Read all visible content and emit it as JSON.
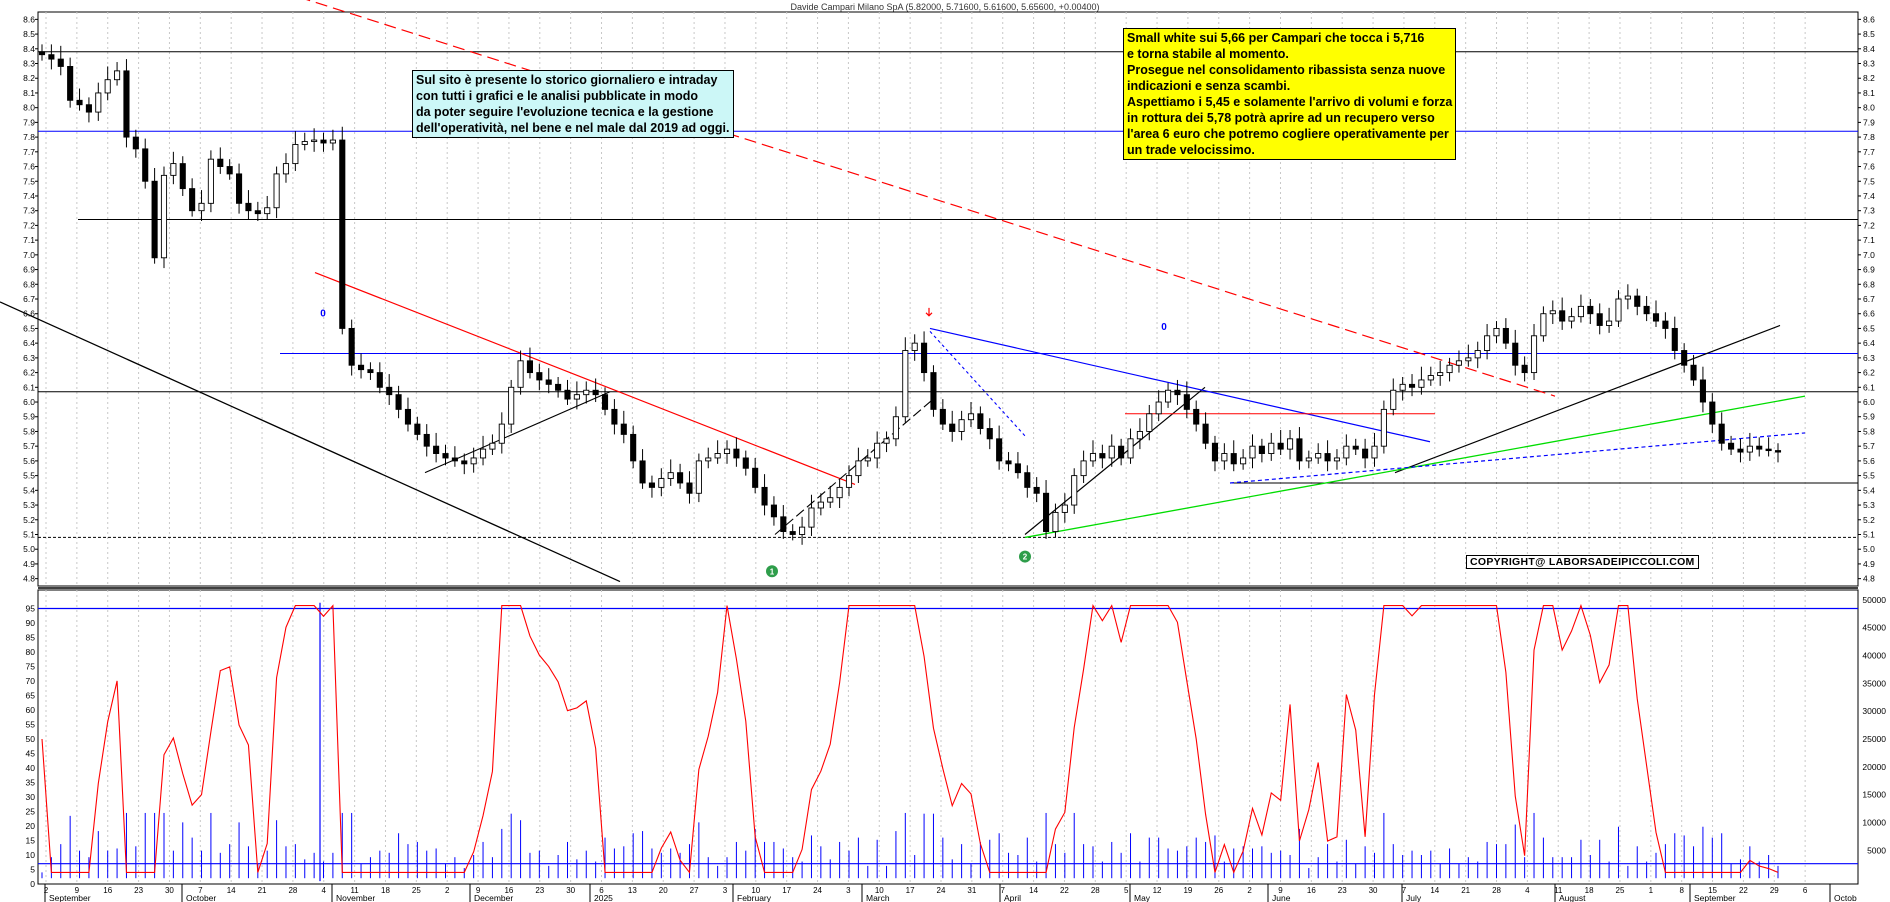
{
  "title": "Davide Campari Milano SpA (5.82000, 5.71600, 5.61600, 5.65600, +0.00400)",
  "notes": {
    "left_box": "Sul sito è presente lo storico giornaliero e intraday\ncon tutti i grafici e le analisi pubblicate in modo\nda poter seguire l'evoluzione tecnica e la gestione\ndell'operatività, nel bene e nel male dal 2019 ad oggi.",
    "right_box": "Small white sui 5,66 per Campari che tocca i 5,716\ne torna stabile al momento.\nProsegue nel consolidamento ribassista senza nuove\nindicazioni e senza scambi.\nAspettiamo i 5,45 e solamente l'arrivo di volumi e forza\nin rottura dei 5,78 potrà aprire ad un recupero verso\nl'area 6 euro che potremo cogliere operativamente per\nun trade velocissimo.",
    "copyright": "COPYRIGHT@ LABORSADEIPICCOLI.COM"
  },
  "colors": {
    "candle": "#000000",
    "trend_red": "#ff0000",
    "trend_blue": "#0000ff",
    "trend_green": "#00dd00",
    "oscillator": "#ff0000",
    "volume": "#0000ff"
  },
  "chart_data": [
    {
      "type": "candlestick",
      "ylim": [
        4.75,
        8.65
      ],
      "y_ticks": [
        "4.8",
        "4.9",
        "5.0",
        "5.1",
        "5.2",
        "5.3",
        "5.4",
        "5.5",
        "5.6",
        "5.7",
        "5.8",
        "5.9",
        "6.0",
        "6.1",
        "6.2",
        "6.3",
        "6.4",
        "6.5",
        "6.6",
        "6.7",
        "6.8",
        "6.9",
        "7.0",
        "7.1",
        "7.2",
        "7.3",
        "7.4",
        "7.5",
        "7.6",
        "7.7",
        "7.8",
        "7.9",
        "8.0",
        "8.1",
        "8.2",
        "8.3",
        "8.4",
        "8.5",
        "8.6"
      ],
      "horizontal_levels": [
        8.38,
        7.84,
        7.24,
        6.33,
        6.07,
        5.45,
        5.08
      ],
      "marker_labels": [
        "1",
        "2",
        "0",
        "0"
      ],
      "closes": [
        8.36,
        8.33,
        8.28,
        8.05,
        8.02,
        7.97,
        8.1,
        8.19,
        8.25,
        7.8,
        7.72,
        7.5,
        6.98,
        7.54,
        7.62,
        7.45,
        7.3,
        7.35,
        7.65,
        7.6,
        7.55,
        7.35,
        7.3,
        7.28,
        7.32,
        7.55,
        7.62,
        7.75,
        7.77,
        7.78,
        7.76,
        7.78,
        6.5,
        6.25,
        6.22,
        6.2,
        6.1,
        6.05,
        5.95,
        5.85,
        5.78,
        5.7,
        5.65,
        5.62,
        5.6,
        5.58,
        5.62,
        5.68,
        5.72,
        5.85,
        6.1,
        6.28,
        6.2,
        6.15,
        6.12,
        6.08,
        6.02,
        6.05,
        6.08,
        6.05,
        5.95,
        5.85,
        5.78,
        5.6,
        5.45,
        5.42,
        5.48,
        5.52,
        5.45,
        5.38,
        5.6,
        5.62,
        5.65,
        5.68,
        5.62,
        5.55,
        5.42,
        5.3,
        5.22,
        5.12,
        5.1,
        5.15,
        5.28,
        5.32,
        5.35,
        5.42,
        5.5,
        5.6,
        5.62,
        5.72,
        5.75,
        5.9,
        6.35,
        6.4,
        6.2,
        5.95,
        5.85,
        5.8,
        5.88,
        5.92,
        5.82,
        5.75,
        5.6,
        5.58,
        5.52,
        5.42,
        5.38,
        5.12,
        5.25,
        5.3,
        5.5,
        5.6,
        5.65,
        5.62,
        5.7,
        5.62,
        5.75,
        5.8,
        5.92,
        6.0,
        6.08,
        6.05,
        5.95,
        5.85,
        5.72,
        5.6,
        5.65,
        5.58,
        5.62,
        5.7,
        5.65,
        5.72,
        5.68,
        5.75,
        5.6,
        5.62,
        5.65,
        5.6,
        5.62,
        5.7,
        5.68,
        5.62,
        5.7,
        5.95,
        6.08,
        6.12,
        6.1,
        6.15,
        6.18,
        6.2,
        6.25,
        6.28,
        6.3,
        6.35,
        6.45,
        6.5,
        6.4,
        6.25,
        6.2,
        6.45,
        6.6,
        6.62,
        6.55,
        6.58,
        6.65,
        6.6,
        6.52,
        6.55,
        6.7,
        6.72,
        6.65,
        6.6,
        6.55,
        6.5,
        6.35,
        6.25,
        6.15,
        6.0,
        5.85,
        5.72,
        5.68,
        5.66,
        5.7,
        5.68,
        5.67,
        5.66
      ]
    },
    {
      "type": "line",
      "name": "oscillator",
      "ylim": [
        0,
        100
      ],
      "y_ticks": [
        "0",
        "5",
        "10",
        "15",
        "20",
        "25",
        "30",
        "35",
        "40",
        "45",
        "50",
        "55",
        "60",
        "65",
        "70",
        "75",
        "80",
        "85",
        "90",
        "95"
      ],
      "volume_ticks": [
        "5000",
        "10000",
        "15000",
        "20000",
        "25000",
        "30000",
        "35000",
        "40000",
        "45000",
        "50000"
      ],
      "reference_levels": [
        95,
        7
      ]
    }
  ],
  "x_axis": {
    "day_labels": [
      "2",
      "9",
      "16",
      "23",
      "30",
      "7",
      "14",
      "21",
      "28",
      "4",
      "11",
      "18",
      "25",
      "2",
      "9",
      "16",
      "23",
      "30",
      "6",
      "13",
      "20",
      "27",
      "3",
      "10",
      "17",
      "24",
      "3",
      "10",
      "17",
      "24",
      "31",
      "7",
      "14",
      "22",
      "28",
      "5",
      "12",
      "19",
      "26",
      "2",
      "9",
      "16",
      "23",
      "30",
      "7",
      "14",
      "21",
      "28",
      "4",
      "11",
      "18",
      "25",
      "1",
      "8",
      "15",
      "22",
      "29",
      "6"
    ],
    "month_labels": [
      "September",
      "October",
      "November",
      "December",
      "2025",
      "February",
      "March",
      "April",
      "May",
      "June",
      "July",
      "August",
      "September",
      "Octob"
    ]
  }
}
